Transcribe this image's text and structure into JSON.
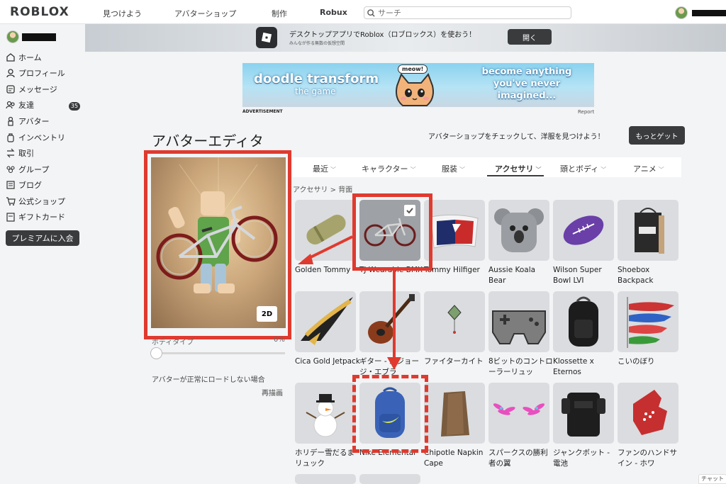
{
  "topnav": {
    "logo": "ROBLOX",
    "links": [
      "見つけよう",
      "アバターショップ",
      "制作",
      "Robux"
    ],
    "search_placeholder": "サーチ"
  },
  "sidebar": {
    "items": [
      {
        "label": "ホーム",
        "icon": "home-icon"
      },
      {
        "label": "プロフィール",
        "icon": "profile-icon"
      },
      {
        "label": "メッセージ",
        "icon": "message-icon"
      },
      {
        "label": "友達",
        "icon": "friends-icon",
        "badge": "35"
      },
      {
        "label": "アバター",
        "icon": "avatar-icon"
      },
      {
        "label": "インベントリ",
        "icon": "inventory-icon"
      },
      {
        "label": "取引",
        "icon": "trade-icon"
      },
      {
        "label": "グループ",
        "icon": "groups-icon"
      },
      {
        "label": "ブログ",
        "icon": "blog-icon"
      },
      {
        "label": "公式ショップ",
        "icon": "shop-icon"
      },
      {
        "label": "ギフトカード",
        "icon": "giftcard-icon"
      }
    ],
    "premium_label": "プレミアムに入会"
  },
  "banner": {
    "title": "デスクトップアプリでRoblox（ロブロックス）を使おう！",
    "subtitle": "みんなが作る無数の仮想空間",
    "open_label": "開く"
  },
  "ad": {
    "left_title": "doodle transform",
    "left_sub": "the game",
    "bubble": "meow!",
    "right_text": "become anything you've never imagined...",
    "label": "ADVERTISEMENT",
    "report": "Report"
  },
  "editor": {
    "title": "アバターエディタ",
    "promo": "アバターショップをチェックして、洋服を見つけよう！",
    "more_label": "もっとゲット",
    "view_2d": "2D",
    "body_type_label": "ボディタイプ",
    "body_type_value": "0%",
    "body_type_fraction": 0,
    "help_text": "アバターが正常にロードしない場合",
    "redraw": "再描画"
  },
  "tabs": {
    "items": [
      "最近",
      "キャラクター",
      "服装",
      "アクセサリ",
      "頭とボディ",
      "アニメ"
    ],
    "active": "アクセサリ"
  },
  "breadcrumb": "アクセサリ > 背面",
  "items": [
    {
      "name": "Golden Tommy",
      "icon": "tommy-bag-icon"
    },
    {
      "name": "TJ Wearable BMX",
      "icon": "bmx-icon",
      "selected": true
    },
    {
      "name": "Tommy Hilfiger",
      "icon": "flag-cape-icon"
    },
    {
      "name": "Aussie Koala Bear",
      "icon": "koala-backpack-icon"
    },
    {
      "name": "Wilson Super Bowl LVI",
      "icon": "football-icon"
    },
    {
      "name": "Shoebox Backpack",
      "icon": "shoebox-icon"
    },
    {
      "name": "Cica Gold Jetpack",
      "icon": "gold-wings-icon"
    },
    {
      "name": "ギター - ルジョージ・エブラ",
      "icon": "guitar-icon"
    },
    {
      "name": "ファイターカイト",
      "icon": "kite-icon"
    },
    {
      "name": "8ビットのコントローラーリュッ",
      "icon": "controller-icon"
    },
    {
      "name": "Klossette x Eternos",
      "icon": "black-backpack-icon"
    },
    {
      "name": "こいのぼり",
      "icon": "koinobori-icon"
    },
    {
      "name": "ホリデー雪だるまリュック",
      "icon": "snowman-icon"
    },
    {
      "name": "Nike Elemental",
      "icon": "nike-backpack-icon"
    },
    {
      "name": "Chipotle Napkin Cape",
      "icon": "cape-icon"
    },
    {
      "name": "スパークスの勝利者の翼",
      "icon": "sparkle-wings-icon"
    },
    {
      "name": "ジャンクボット - 電池",
      "icon": "battery-icon"
    },
    {
      "name": "ファンのハンドサイン - ホワ",
      "icon": "foam-hand-icon"
    }
  ],
  "chat": "チャット"
}
